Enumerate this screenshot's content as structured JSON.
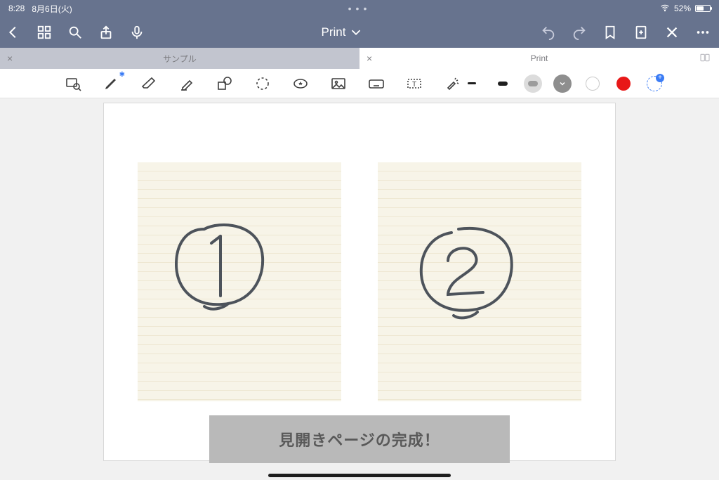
{
  "status": {
    "time": "8:28",
    "date": "8月6日(火)",
    "battery_pct": "52%"
  },
  "app": {
    "title": "Print"
  },
  "tabs": {
    "inactive_label": "サンプル",
    "active_label": "Print"
  },
  "tools": {
    "zoom": "zoom-to-fit",
    "pen": "pen",
    "eraser": "eraser",
    "highlighter": "highlighter",
    "shapes": "shapes",
    "lasso": "lasso",
    "sticker": "favorite-stamp",
    "image": "image",
    "keyboard": "keyboard",
    "textbox": "text-box",
    "ruler": "laser-pointer"
  },
  "colors": {
    "red": "#e81818",
    "accent": "#3b7cf5"
  },
  "canvas": {
    "banner_text": "見開きページの完成！",
    "page_numbers": [
      "1",
      "2"
    ]
  }
}
